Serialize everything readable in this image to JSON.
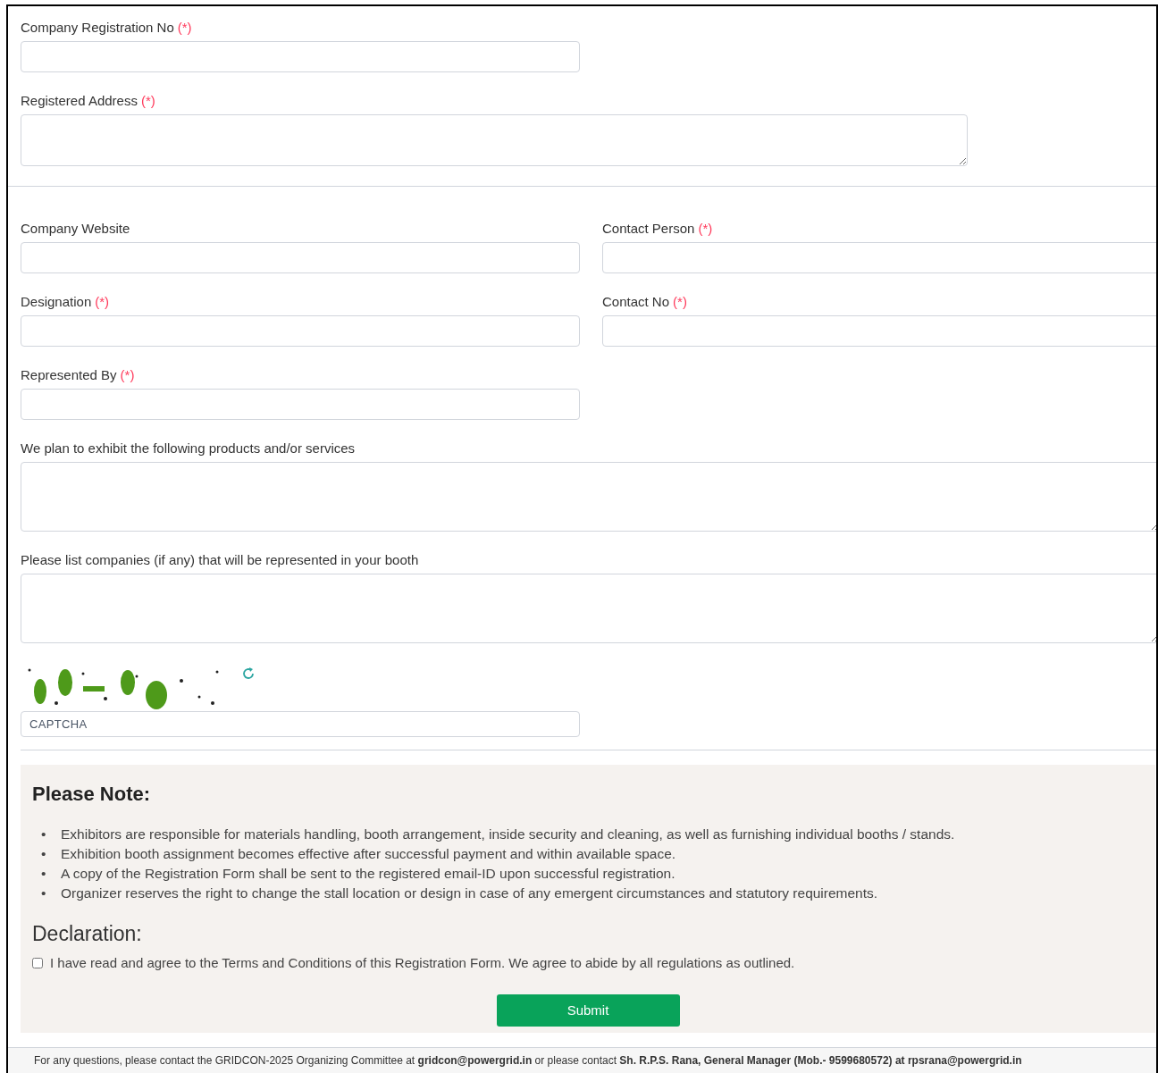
{
  "registration_fields": [
    {
      "label": "Company Registration No",
      "required": true,
      "kind": "input"
    },
    {
      "label": "Registered Address",
      "required": true,
      "kind": "textarea"
    }
  ],
  "contact_fields": [
    {
      "label": "Company Website",
      "required": false,
      "kind": "input"
    },
    {
      "label": "Contact Person",
      "required": true,
      "kind": "input"
    },
    {
      "label": "Designation",
      "required": true,
      "kind": "input"
    },
    {
      "label": "Contact No",
      "required": true,
      "kind": "input"
    },
    {
      "label": "Represented By",
      "required": true,
      "kind": "input"
    }
  ],
  "description_fields": [
    {
      "label": "We plan to exhibit the following products and/or services",
      "required": false,
      "kind": "textarea"
    },
    {
      "label": "Please list companies (if any) that will be represented in your booth",
      "required": false,
      "kind": "textarea"
    }
  ],
  "required_mark": "(*)",
  "captcha": {
    "placeholder": "CAPTCHA"
  },
  "note": {
    "title": "Please Note:",
    "bullet": "•",
    "items": [
      "Exhibitors are responsible for materials handling, booth arrangement, inside security and cleaning, as well as furnishing individual booths / stands.",
      "Exhibition booth assignment becomes effective after successful payment and within available space.",
      "A copy of the Registration Form shall be sent to the registered email-ID upon successful registration.",
      "Organizer reserves the right to change the stall location or design in case of any emergent circumstances and statutory requirements."
    ]
  },
  "declaration": {
    "title": "Declaration:",
    "label": "I have read and agree to the Terms and Conditions of this Registration Form. We agree to abide by all regulations as outlined.",
    "checked": false
  },
  "submit": {
    "label": "Submit"
  },
  "footer": "For any questions, please contact the GRIDCON-2025 Organizing Committee at **gridcon@powergrid.in** or please contact **Sh. R.P.S. Rana, General Manager (Mob.- 9599680572) at rpsrana@powergrid.in**"
}
